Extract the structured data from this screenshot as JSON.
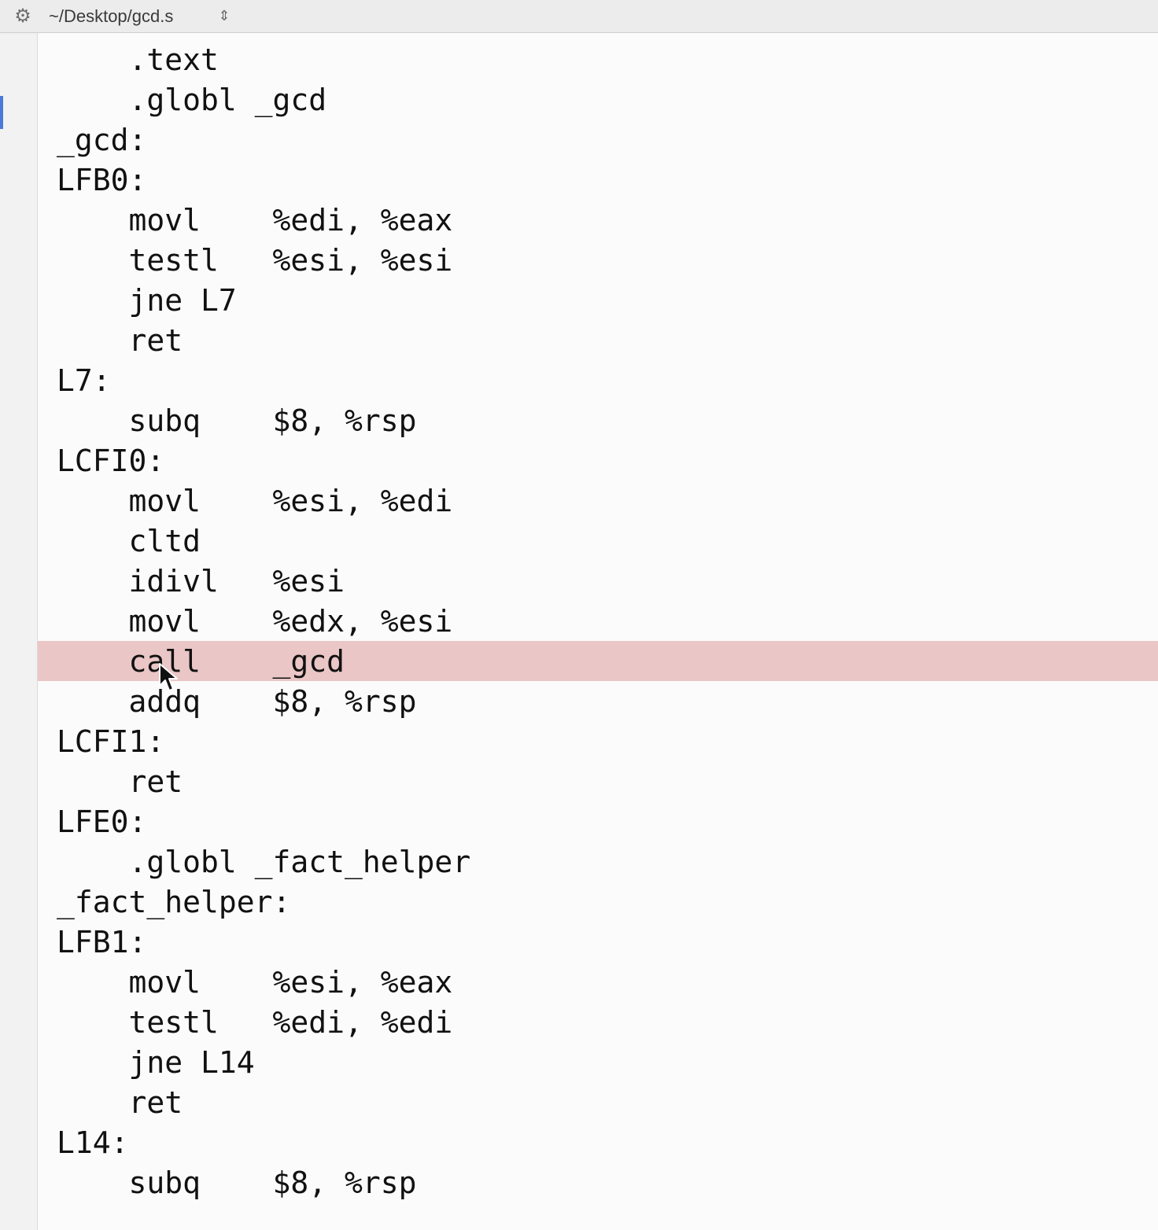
{
  "window": {
    "file_path": "~/Desktop/gcd.s",
    "gear_icon": "gear-icon",
    "path_chevron_icon": "chevron-up-down-icon"
  },
  "colors": {
    "highlight_line": "#ebc6c6",
    "gutter_marker": "#4a7bd8"
  },
  "editor": {
    "highlighted_line_index": 15,
    "lines": [
      "    .text",
      "    .globl _gcd",
      "_gcd:",
      "LFB0:",
      "    movl    %edi, %eax",
      "    testl   %esi, %esi",
      "    jne L7",
      "    ret",
      "L7:",
      "    subq    $8, %rsp",
      "LCFI0:",
      "    movl    %esi, %edi",
      "    cltd",
      "    idivl   %esi",
      "    movl    %edx, %esi",
      "    call    _gcd",
      "    addq    $8, %rsp",
      "LCFI1:",
      "    ret",
      "LFE0:",
      "    .globl _fact_helper",
      "_fact_helper:",
      "LFB1:",
      "    movl    %esi, %eax",
      "    testl   %edi, %edi",
      "    jne L14",
      "    ret",
      "L14:",
      "    subq    $8, %rsp"
    ]
  }
}
